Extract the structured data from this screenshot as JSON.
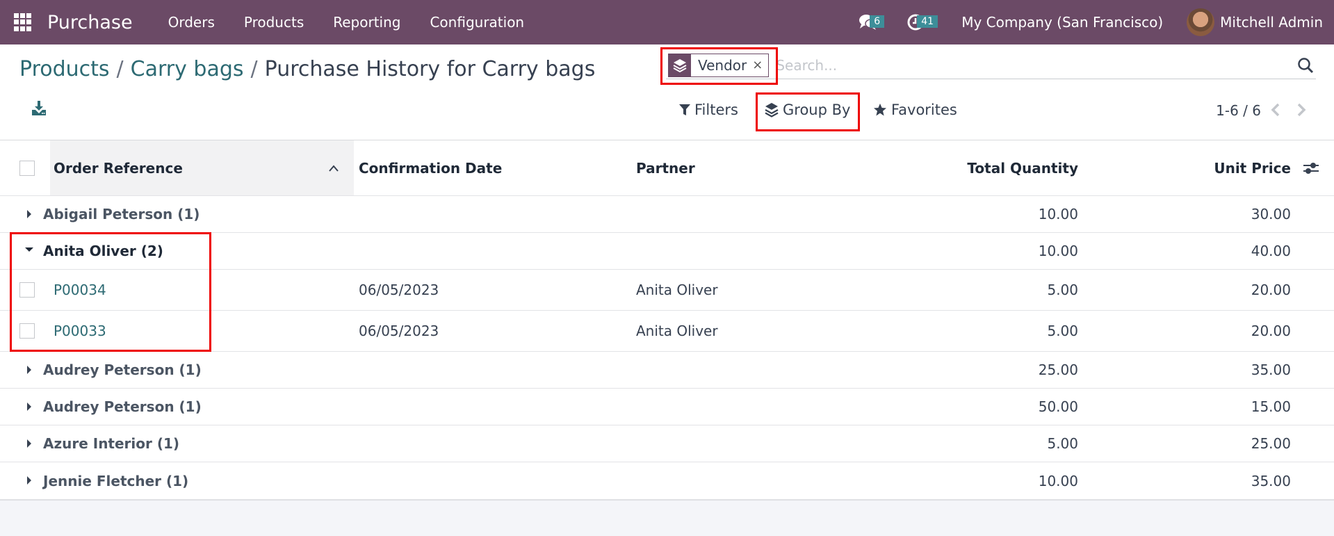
{
  "navbar": {
    "app_name": "Purchase",
    "menu": [
      "Orders",
      "Products",
      "Reporting",
      "Configuration"
    ],
    "messages_count": "6",
    "activities_count": "41",
    "company": "My Company (San Francisco)",
    "user": "Mitchell Admin",
    "colors": {
      "bar": "#6b4a66",
      "badge": "#3d8e99"
    }
  },
  "breadcrumb": {
    "items": [
      "Products",
      "Carry bags"
    ],
    "current": "Purchase History for Carry bags",
    "separator": "/"
  },
  "search": {
    "facet_label": "Vendor",
    "facet_icon": "group-by-layers-icon",
    "facet_close": "×",
    "placeholder": "Search..."
  },
  "toolbar": {
    "filters": "Filters",
    "group_by": "Group By",
    "favorites": "Favorites",
    "pager": "1-6 / 6"
  },
  "table": {
    "columns": {
      "order_reference": "Order Reference",
      "confirmation_date": "Confirmation Date",
      "partner": "Partner",
      "total_quantity": "Total Quantity",
      "unit_price": "Unit Price"
    },
    "groups": [
      {
        "name": "Abigail Peterson (1)",
        "expanded": false,
        "total_quantity": "10.00",
        "unit_price": "30.00",
        "records": []
      },
      {
        "name": "Anita Oliver (2)",
        "expanded": true,
        "total_quantity": "10.00",
        "unit_price": "40.00",
        "records": [
          {
            "ref": "P00034",
            "date": "06/05/2023",
            "partner": "Anita Oliver",
            "quantity": "5.00",
            "price": "20.00"
          },
          {
            "ref": "P00033",
            "date": "06/05/2023",
            "partner": "Anita Oliver",
            "quantity": "5.00",
            "price": "20.00"
          }
        ]
      },
      {
        "name": "Audrey Peterson (1)",
        "expanded": false,
        "total_quantity": "25.00",
        "unit_price": "35.00",
        "records": []
      },
      {
        "name": "Audrey Peterson (1)",
        "expanded": false,
        "total_quantity": "50.00",
        "unit_price": "15.00",
        "records": []
      },
      {
        "name": "Azure Interior (1)",
        "expanded": false,
        "total_quantity": "5.00",
        "unit_price": "25.00",
        "records": []
      },
      {
        "name": "Jennie Fletcher (1)",
        "expanded": false,
        "total_quantity": "10.00",
        "unit_price": "35.00",
        "records": []
      }
    ]
  },
  "annotations": {
    "highlight_color": "#ee0000"
  }
}
